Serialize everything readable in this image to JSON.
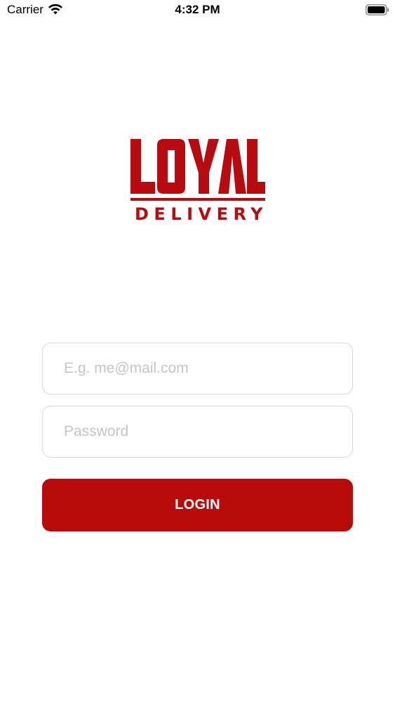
{
  "status_bar": {
    "carrier": "Carrier",
    "time": "4:32 PM",
    "wifi_icon": "wifi-icon",
    "battery_icon": "battery-icon"
  },
  "logo": {
    "wordmark": "LOYAL",
    "subtitle": "DELIVERY",
    "brand_color": "#b80b10"
  },
  "login_form": {
    "email": {
      "value": "",
      "placeholder": "E.g. me@mail.com"
    },
    "password": {
      "value": "",
      "placeholder": "Password"
    },
    "login_label": "LOGIN"
  },
  "colors": {
    "accent": "#b80b0b",
    "field_border": "#d9d9de",
    "placeholder": "#c4c4c9",
    "background": "#ffffff"
  }
}
